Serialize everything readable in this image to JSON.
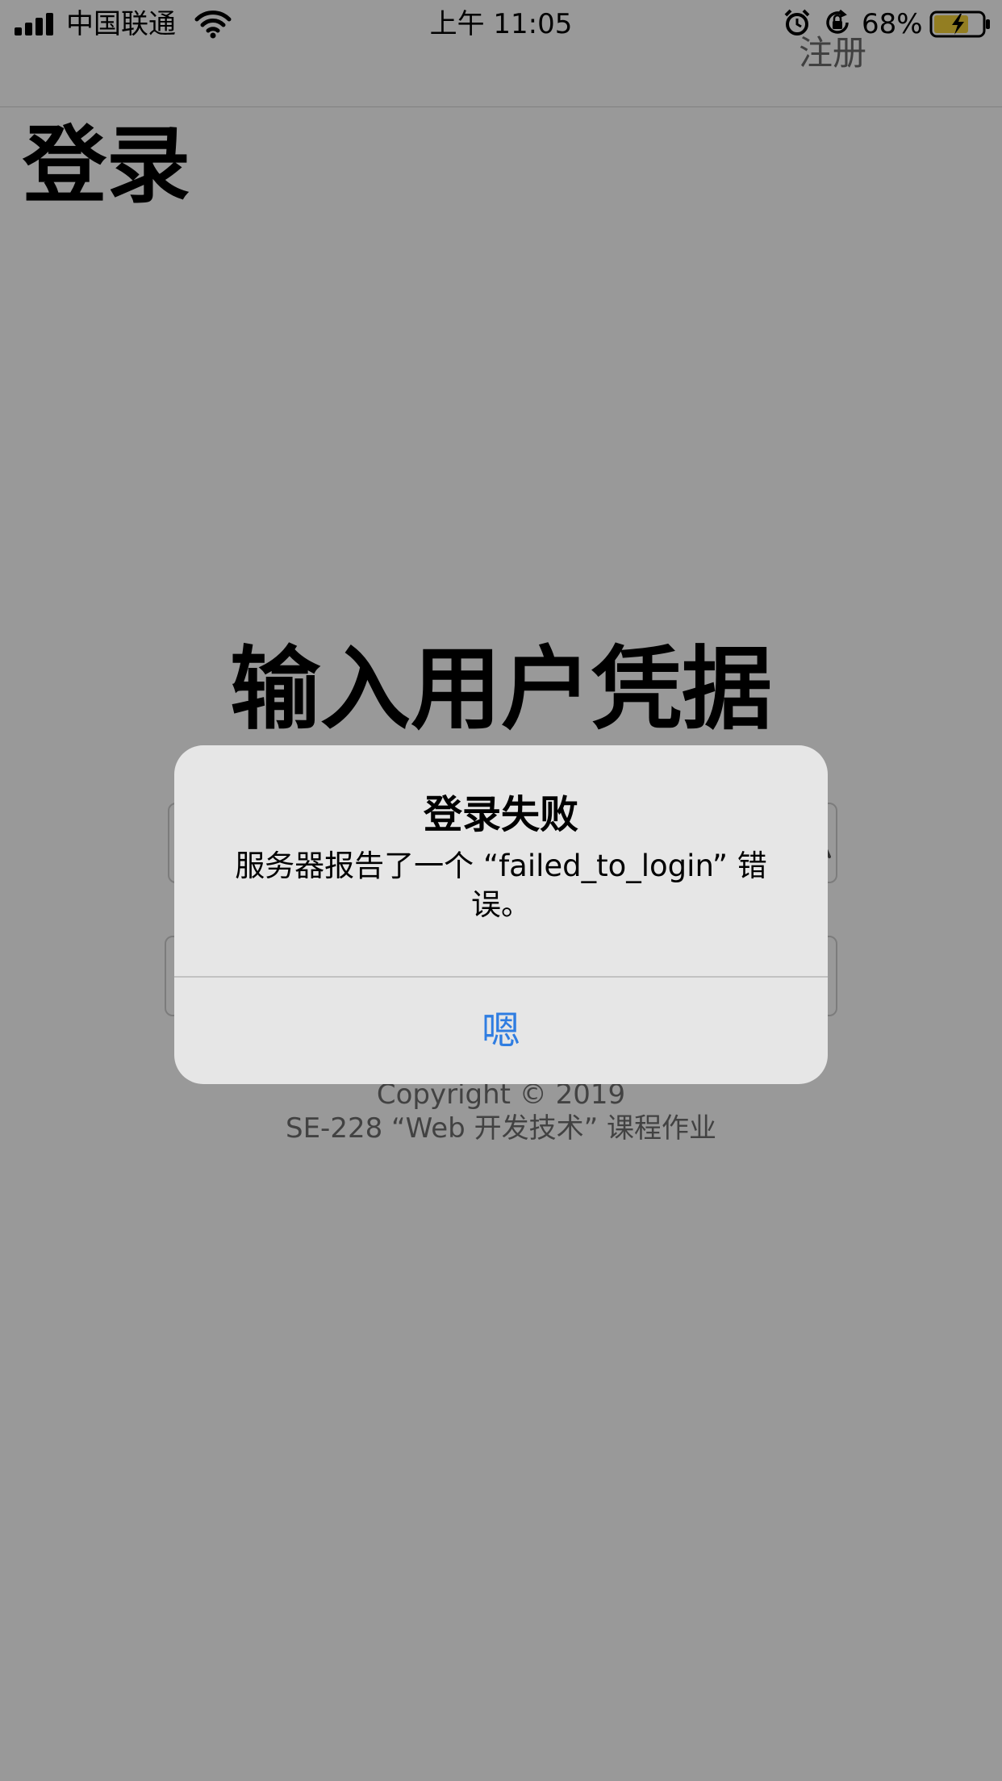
{
  "status_bar": {
    "carrier": "中国联通",
    "time": "上午 11:05",
    "battery_percent": "68%",
    "signal_icon": "cellular-signal-icon",
    "wifi_icon": "wifi-icon",
    "alarm_icon": "alarm-icon",
    "orientation_lock_icon": "orientation-lock-icon",
    "battery_icon": "battery-charging-icon"
  },
  "nav": {
    "register_label": "注册",
    "title": "登录"
  },
  "main": {
    "heading": "输入用户凭据",
    "copyright": "Copyright © 2019",
    "course": "SE-228 “Web 开发技术” 课程作业"
  },
  "alert": {
    "title": "登录失败",
    "message": "服务器报告了一个 “failed_to_login” 错误。",
    "button_label": "嗯",
    "button_color": "#2f7de1"
  },
  "colors": {
    "overlay": "#999999",
    "alert_background": "#e6e6e6",
    "battery_fill": "#f5d33a"
  }
}
